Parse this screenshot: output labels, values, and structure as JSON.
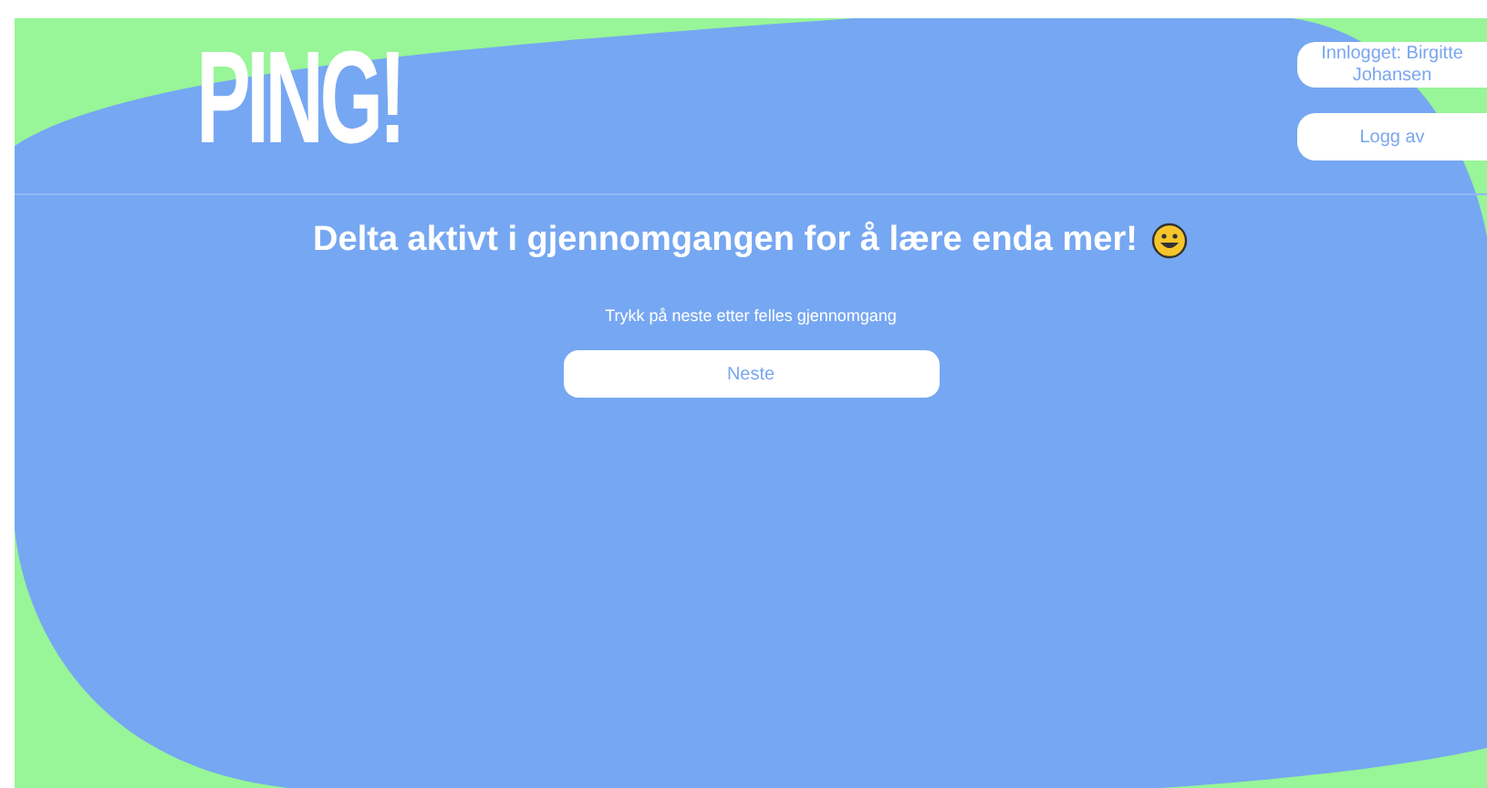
{
  "header": {
    "logo": "PING!",
    "user_label": "Innlogget: Birgitte Johansen",
    "logout_button": "Logg av"
  },
  "main": {
    "heading": "Delta aktivt i gjennomgangen for å lære enda mer!",
    "instruction": "Trykk på neste etter felles gjennomgang",
    "next_button": "Neste"
  }
}
